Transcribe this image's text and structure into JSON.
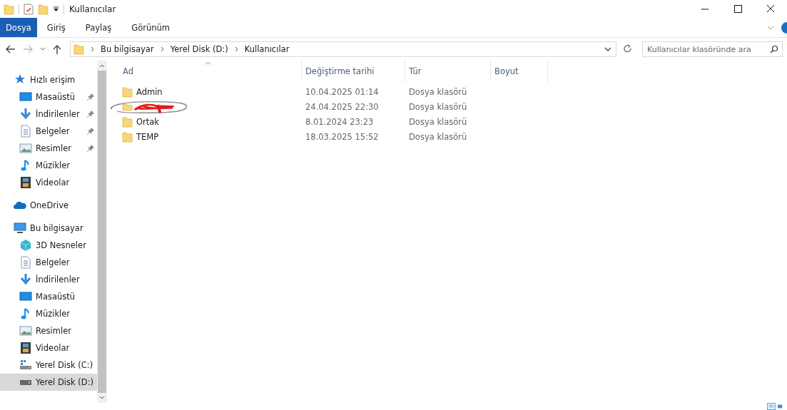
{
  "window": {
    "title": "Kullanıcılar"
  },
  "ribbon_tabs": [
    {
      "label": "Dosya",
      "selected": true
    },
    {
      "label": "Giriş",
      "selected": false
    },
    {
      "label": "Paylaş",
      "selected": false
    },
    {
      "label": "Görünüm",
      "selected": false
    }
  ],
  "address_bar": {
    "path": [
      "Bu bilgisayar",
      "Yerel Disk (D:)",
      "Kullanıcılar"
    ]
  },
  "search": {
    "placeholder": "Kullanıcılar klasöründe ara"
  },
  "sidebar": {
    "items": [
      {
        "label": "Hızlı erişim",
        "kind": "star",
        "selected": false,
        "children": [
          {
            "label": "Masaüstü",
            "kind": "desktop",
            "pinned": true,
            "selected": false
          },
          {
            "label": "İndirilenler",
            "kind": "download",
            "pinned": true,
            "selected": false
          },
          {
            "label": "Belgeler",
            "kind": "document",
            "pinned": true,
            "selected": false
          },
          {
            "label": "Resimler",
            "kind": "pictures",
            "pinned": true,
            "selected": false
          },
          {
            "label": "Müzikler",
            "kind": "music",
            "pinned": false,
            "selected": false
          },
          {
            "label": "Videolar",
            "kind": "video",
            "pinned": false,
            "selected": false
          }
        ]
      },
      {
        "label": "OneDrive",
        "kind": "cloud",
        "selected": false
      },
      {
        "label": "Bu bilgisayar",
        "kind": "computer",
        "selected": false,
        "children": [
          {
            "label": "3D Nesneler",
            "kind": "cube",
            "selected": false
          },
          {
            "label": "Belgeler",
            "kind": "document",
            "selected": false
          },
          {
            "label": "İndirilenler",
            "kind": "download",
            "selected": false
          },
          {
            "label": "Masaüstü",
            "kind": "desktop",
            "selected": false
          },
          {
            "label": "Müzikler",
            "kind": "music",
            "selected": false
          },
          {
            "label": "Resimler",
            "kind": "pictures",
            "selected": false
          },
          {
            "label": "Videolar",
            "kind": "video",
            "selected": false
          },
          {
            "label": "Yerel Disk (C:)",
            "kind": "system-drive",
            "selected": false
          },
          {
            "label": "Yerel Disk (D:)",
            "kind": "drive",
            "selected": true
          }
        ]
      }
    ]
  },
  "table": {
    "columns": [
      "Ad",
      "Değiştirme tarihi",
      "Tür",
      "Boyut"
    ],
    "rows": [
      {
        "kind": "plain",
        "name": "Admin",
        "date": "10.04.2025 01:14",
        "type": "Dosya klasörü"
      },
      {
        "kind": "scribbled",
        "date": "24.04.2025 22:30",
        "type": "Dosya klasörü"
      },
      {
        "kind": "plain",
        "name": "Ortak",
        "date": "8.01.2024 23:23",
        "type": "Dosya klasörü"
      },
      {
        "kind": "plain",
        "name": "TEMP",
        "date": "18.03.2025 15:52",
        "type": "Dosya klasörü"
      }
    ]
  },
  "status_bar": {
    "views": [
      {
        "selected": true
      },
      {
        "selected": false
      }
    ]
  }
}
